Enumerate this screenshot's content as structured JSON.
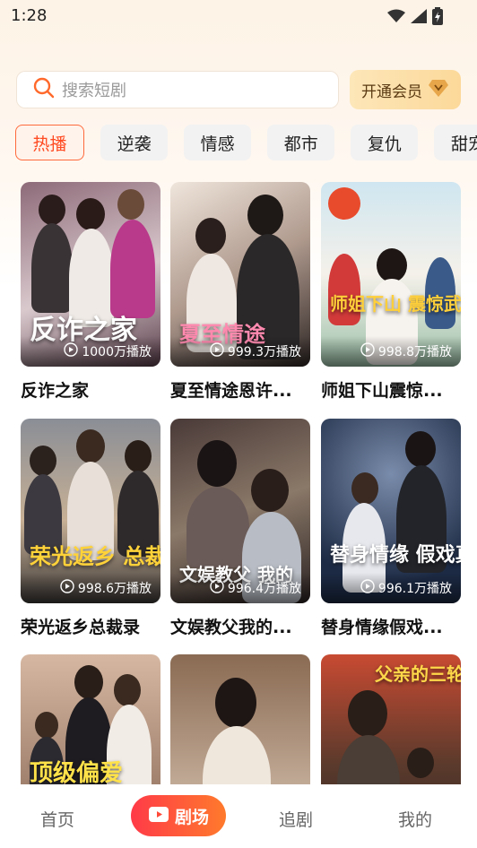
{
  "status": {
    "time": "1:28"
  },
  "search": {
    "placeholder": "搜索短剧"
  },
  "vip": {
    "label": "开通会员"
  },
  "categories": [
    "热播",
    "逆袭",
    "情感",
    "都市",
    "复仇",
    "甜宠"
  ],
  "dramas": [
    {
      "title": "反诈之家",
      "poster_text": "反诈之家",
      "plays": "1000万播放",
      "colors": [
        "#7f5a6a",
        "#d6c3c8"
      ]
    },
    {
      "title": "夏至情途恩许...",
      "poster_text": "夏至情途",
      "plays": "999.3万播放",
      "colors": [
        "#3a2e2c",
        "#a88a80"
      ]
    },
    {
      "title": "师姐下山震惊...",
      "poster_text": "师姐下山 震惊武林",
      "plays": "998.8万播放",
      "colors": [
        "#bfe0ee",
        "#f4f0e8"
      ]
    },
    {
      "title": "荣光返乡总裁录",
      "poster_text": "荣光返乡 总裁录",
      "plays": "998.6万播放",
      "colors": [
        "#5b5a5e",
        "#c9a27a"
      ]
    },
    {
      "title": "文娱教父我的...",
      "poster_text": "文娱教父 我的",
      "plays": "996.4万播放",
      "colors": [
        "#3c3232",
        "#7a6a5e"
      ]
    },
    {
      "title": "替身情缘假戏...",
      "poster_text": "替身情缘 假戏真做",
      "plays": "996.1万播放",
      "colors": [
        "#1f2e48",
        "#6a7d9c"
      ]
    },
    {
      "title": "",
      "poster_text": "顶级偏爱",
      "plays": "",
      "colors": [
        "#c6a590",
        "#6a4c3e"
      ]
    },
    {
      "title": "",
      "poster_text": "",
      "plays": "",
      "colors": [
        "#8a6a52",
        "#d7c4b2"
      ]
    },
    {
      "title": "",
      "poster_text": "父亲的三轮车",
      "plays": "",
      "colors": [
        "#c84a32",
        "#3a2a24"
      ]
    }
  ],
  "nav": {
    "home": "首页",
    "theater": "剧场",
    "follow": "追剧",
    "mine": "我的"
  }
}
